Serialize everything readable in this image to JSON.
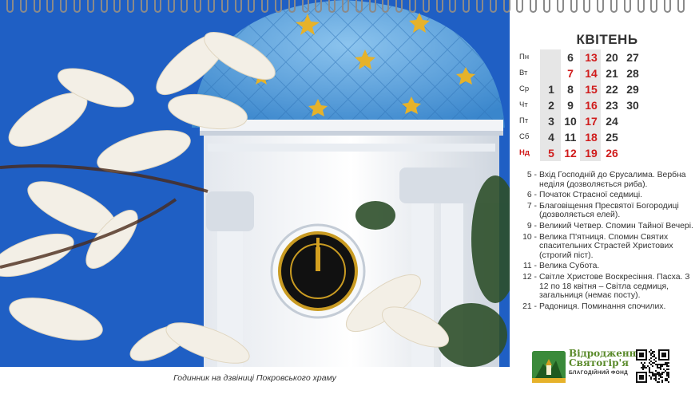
{
  "caption": "Годинник на дзвіниці Покровського храму",
  "calendar": {
    "month": "КВІТЕНЬ",
    "rows": [
      {
        "day": "Пн",
        "red": false,
        "cells": [
          {
            "v": "",
            "r": false
          },
          {
            "v": "6",
            "r": false
          },
          {
            "v": "13",
            "r": true
          },
          {
            "v": "20",
            "r": false
          },
          {
            "v": "27",
            "r": false
          }
        ]
      },
      {
        "day": "Вт",
        "red": false,
        "cells": [
          {
            "v": "",
            "r": false
          },
          {
            "v": "7",
            "r": true
          },
          {
            "v": "14",
            "r": true
          },
          {
            "v": "21",
            "r": false
          },
          {
            "v": "28",
            "r": false
          }
        ]
      },
      {
        "day": "Ср",
        "red": false,
        "cells": [
          {
            "v": "1",
            "r": false
          },
          {
            "v": "8",
            "r": false
          },
          {
            "v": "15",
            "r": true
          },
          {
            "v": "22",
            "r": false
          },
          {
            "v": "29",
            "r": false
          }
        ]
      },
      {
        "day": "Чт",
        "red": false,
        "cells": [
          {
            "v": "2",
            "r": false
          },
          {
            "v": "9",
            "r": false
          },
          {
            "v": "16",
            "r": true
          },
          {
            "v": "23",
            "r": false
          },
          {
            "v": "30",
            "r": false
          }
        ]
      },
      {
        "day": "Пт",
        "red": false,
        "cells": [
          {
            "v": "3",
            "r": false
          },
          {
            "v": "10",
            "r": false
          },
          {
            "v": "17",
            "r": true
          },
          {
            "v": "24",
            "r": false
          },
          {
            "v": "",
            "r": false
          }
        ]
      },
      {
        "day": "Сб",
        "red": false,
        "cells": [
          {
            "v": "4",
            "r": false
          },
          {
            "v": "11",
            "r": false
          },
          {
            "v": "18",
            "r": true
          },
          {
            "v": "25",
            "r": false
          },
          {
            "v": "",
            "r": false
          }
        ]
      },
      {
        "day": "Нд",
        "red": true,
        "cells": [
          {
            "v": "5",
            "r": true
          },
          {
            "v": "12",
            "r": true
          },
          {
            "v": "19",
            "r": true
          },
          {
            "v": "26",
            "r": true
          },
          {
            "v": "",
            "r": false
          }
        ]
      }
    ]
  },
  "holidays": [
    {
      "num": "5 -",
      "text": "Вхід Господній до Єрусалима. Вербна неділя (дозволяється риба)."
    },
    {
      "num": "6 -",
      "text": "Початок Страсної седмиці."
    },
    {
      "num": "7 -",
      "text": "Благовіщення Пресвятої Богородиці (дозволяється елей)."
    },
    {
      "num": "9 -",
      "text": "Великий Четвер. Спомин Тайної Вечері."
    },
    {
      "num": "10 -",
      "text": "Велика П'ятниця. Спомин Святих спасительних Страстей Христових (строгий піст)."
    },
    {
      "num": "11 -",
      "text": "Велика Субота."
    },
    {
      "num": "12 -",
      "text": "Світле Христове Воскресіння. Пасха. З 12 по 18 квітня – Світла седмиця, загальниця (немає посту)."
    },
    {
      "num": "21 -",
      "text": "Радониця. Поминання спочилих."
    }
  ],
  "brand": {
    "name_line1": "Відродження",
    "name_line2": "Святогір'я",
    "subtitle": "БЛАГОДІЙНИЙ ФОНД"
  },
  "colors": {
    "accent_red": "#d01c1c",
    "sky": "#1f5fc4",
    "dome": "#5aa6e0",
    "gold": "#d4a020",
    "brand_green": "#5a8a2a"
  },
  "icons": [
    "spiral-binding",
    "church-logo-icon",
    "qr-code"
  ]
}
